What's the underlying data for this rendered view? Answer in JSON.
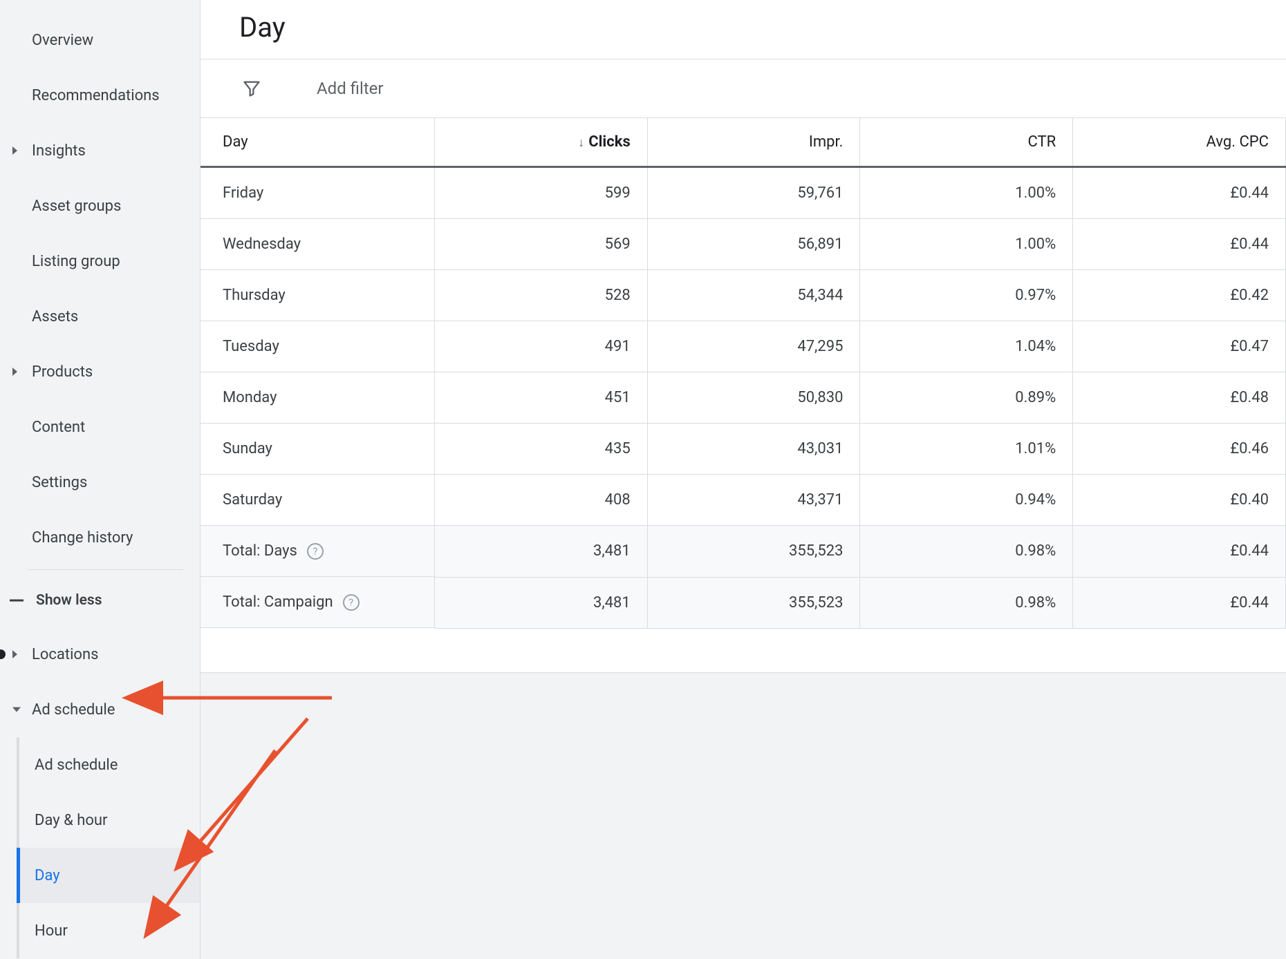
{
  "sidebar": {
    "items": [
      {
        "label": "Overview",
        "caret": false
      },
      {
        "label": "Recommendations",
        "caret": false
      },
      {
        "label": "Insights",
        "caret": true
      },
      {
        "label": "Asset groups",
        "caret": false
      },
      {
        "label": "Listing group",
        "caret": false
      },
      {
        "label": "Assets",
        "caret": false
      },
      {
        "label": "Products",
        "caret": true
      },
      {
        "label": "Content",
        "caret": false
      },
      {
        "label": "Settings",
        "caret": false
      },
      {
        "label": "Change history",
        "caret": false
      }
    ],
    "show_less": "Show less",
    "locations": "Locations",
    "ad_schedule": "Ad schedule",
    "sub": {
      "ad_schedule": "Ad schedule",
      "day_hour": "Day & hour",
      "day": "Day",
      "hour": "Hour"
    }
  },
  "page": {
    "title": "Day",
    "add_filter": "Add filter"
  },
  "table": {
    "headers": {
      "day": "Day",
      "clicks": "Clicks",
      "impr": "Impr.",
      "ctr": "CTR",
      "avg_cpc": "Avg. CPC"
    },
    "rows": [
      {
        "day": "Friday",
        "clicks": "599",
        "impr": "59,761",
        "ctr": "1.00%",
        "avg_cpc": "£0.44"
      },
      {
        "day": "Wednesday",
        "clicks": "569",
        "impr": "56,891",
        "ctr": "1.00%",
        "avg_cpc": "£0.44"
      },
      {
        "day": "Thursday",
        "clicks": "528",
        "impr": "54,344",
        "ctr": "0.97%",
        "avg_cpc": "£0.42"
      },
      {
        "day": "Tuesday",
        "clicks": "491",
        "impr": "47,295",
        "ctr": "1.04%",
        "avg_cpc": "£0.47"
      },
      {
        "day": "Monday",
        "clicks": "451",
        "impr": "50,830",
        "ctr": "0.89%",
        "avg_cpc": "£0.48"
      },
      {
        "day": "Sunday",
        "clicks": "435",
        "impr": "43,031",
        "ctr": "1.01%",
        "avg_cpc": "£0.46"
      },
      {
        "day": "Saturday",
        "clicks": "408",
        "impr": "43,371",
        "ctr": "0.94%",
        "avg_cpc": "£0.40"
      }
    ],
    "totals": [
      {
        "label": "Total: Days",
        "clicks": "3,481",
        "impr": "355,523",
        "ctr": "0.98%",
        "avg_cpc": "£0.44"
      },
      {
        "label": "Total: Campaign",
        "clicks": "3,481",
        "impr": "355,523",
        "ctr": "0.98%",
        "avg_cpc": "£0.44"
      }
    ]
  }
}
